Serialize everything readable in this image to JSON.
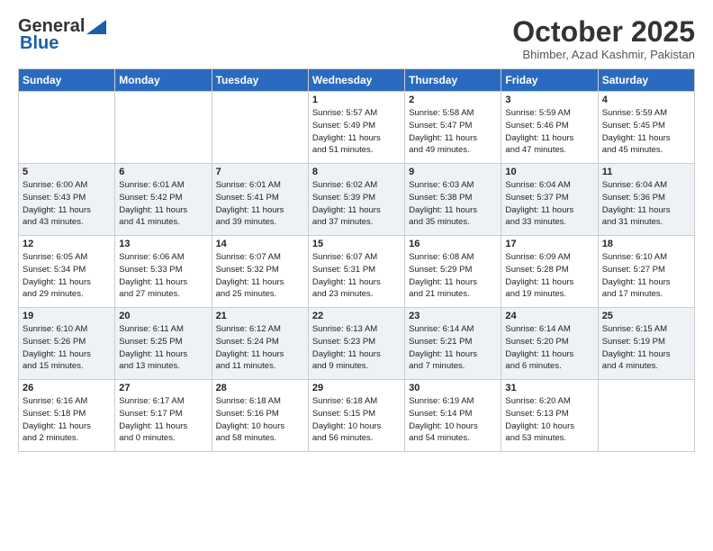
{
  "header": {
    "logo_general": "General",
    "logo_blue": "Blue",
    "month_title": "October 2025",
    "location": "Bhimber, Azad Kashmir, Pakistan"
  },
  "days_of_week": [
    "Sunday",
    "Monday",
    "Tuesday",
    "Wednesday",
    "Thursday",
    "Friday",
    "Saturday"
  ],
  "weeks": [
    [
      {
        "day": "",
        "info": ""
      },
      {
        "day": "",
        "info": ""
      },
      {
        "day": "",
        "info": ""
      },
      {
        "day": "1",
        "info": "Sunrise: 5:57 AM\nSunset: 5:49 PM\nDaylight: 11 hours\nand 51 minutes."
      },
      {
        "day": "2",
        "info": "Sunrise: 5:58 AM\nSunset: 5:47 PM\nDaylight: 11 hours\nand 49 minutes."
      },
      {
        "day": "3",
        "info": "Sunrise: 5:59 AM\nSunset: 5:46 PM\nDaylight: 11 hours\nand 47 minutes."
      },
      {
        "day": "4",
        "info": "Sunrise: 5:59 AM\nSunset: 5:45 PM\nDaylight: 11 hours\nand 45 minutes."
      }
    ],
    [
      {
        "day": "5",
        "info": "Sunrise: 6:00 AM\nSunset: 5:43 PM\nDaylight: 11 hours\nand 43 minutes."
      },
      {
        "day": "6",
        "info": "Sunrise: 6:01 AM\nSunset: 5:42 PM\nDaylight: 11 hours\nand 41 minutes."
      },
      {
        "day": "7",
        "info": "Sunrise: 6:01 AM\nSunset: 5:41 PM\nDaylight: 11 hours\nand 39 minutes."
      },
      {
        "day": "8",
        "info": "Sunrise: 6:02 AM\nSunset: 5:39 PM\nDaylight: 11 hours\nand 37 minutes."
      },
      {
        "day": "9",
        "info": "Sunrise: 6:03 AM\nSunset: 5:38 PM\nDaylight: 11 hours\nand 35 minutes."
      },
      {
        "day": "10",
        "info": "Sunrise: 6:04 AM\nSunset: 5:37 PM\nDaylight: 11 hours\nand 33 minutes."
      },
      {
        "day": "11",
        "info": "Sunrise: 6:04 AM\nSunset: 5:36 PM\nDaylight: 11 hours\nand 31 minutes."
      }
    ],
    [
      {
        "day": "12",
        "info": "Sunrise: 6:05 AM\nSunset: 5:34 PM\nDaylight: 11 hours\nand 29 minutes."
      },
      {
        "day": "13",
        "info": "Sunrise: 6:06 AM\nSunset: 5:33 PM\nDaylight: 11 hours\nand 27 minutes."
      },
      {
        "day": "14",
        "info": "Sunrise: 6:07 AM\nSunset: 5:32 PM\nDaylight: 11 hours\nand 25 minutes."
      },
      {
        "day": "15",
        "info": "Sunrise: 6:07 AM\nSunset: 5:31 PM\nDaylight: 11 hours\nand 23 minutes."
      },
      {
        "day": "16",
        "info": "Sunrise: 6:08 AM\nSunset: 5:29 PM\nDaylight: 11 hours\nand 21 minutes."
      },
      {
        "day": "17",
        "info": "Sunrise: 6:09 AM\nSunset: 5:28 PM\nDaylight: 11 hours\nand 19 minutes."
      },
      {
        "day": "18",
        "info": "Sunrise: 6:10 AM\nSunset: 5:27 PM\nDaylight: 11 hours\nand 17 minutes."
      }
    ],
    [
      {
        "day": "19",
        "info": "Sunrise: 6:10 AM\nSunset: 5:26 PM\nDaylight: 11 hours\nand 15 minutes."
      },
      {
        "day": "20",
        "info": "Sunrise: 6:11 AM\nSunset: 5:25 PM\nDaylight: 11 hours\nand 13 minutes."
      },
      {
        "day": "21",
        "info": "Sunrise: 6:12 AM\nSunset: 5:24 PM\nDaylight: 11 hours\nand 11 minutes."
      },
      {
        "day": "22",
        "info": "Sunrise: 6:13 AM\nSunset: 5:23 PM\nDaylight: 11 hours\nand 9 minutes."
      },
      {
        "day": "23",
        "info": "Sunrise: 6:14 AM\nSunset: 5:21 PM\nDaylight: 11 hours\nand 7 minutes."
      },
      {
        "day": "24",
        "info": "Sunrise: 6:14 AM\nSunset: 5:20 PM\nDaylight: 11 hours\nand 6 minutes."
      },
      {
        "day": "25",
        "info": "Sunrise: 6:15 AM\nSunset: 5:19 PM\nDaylight: 11 hours\nand 4 minutes."
      }
    ],
    [
      {
        "day": "26",
        "info": "Sunrise: 6:16 AM\nSunset: 5:18 PM\nDaylight: 11 hours\nand 2 minutes."
      },
      {
        "day": "27",
        "info": "Sunrise: 6:17 AM\nSunset: 5:17 PM\nDaylight: 11 hours\nand 0 minutes."
      },
      {
        "day": "28",
        "info": "Sunrise: 6:18 AM\nSunset: 5:16 PM\nDaylight: 10 hours\nand 58 minutes."
      },
      {
        "day": "29",
        "info": "Sunrise: 6:18 AM\nSunset: 5:15 PM\nDaylight: 10 hours\nand 56 minutes."
      },
      {
        "day": "30",
        "info": "Sunrise: 6:19 AM\nSunset: 5:14 PM\nDaylight: 10 hours\nand 54 minutes."
      },
      {
        "day": "31",
        "info": "Sunrise: 6:20 AM\nSunset: 5:13 PM\nDaylight: 10 hours\nand 53 minutes."
      },
      {
        "day": "",
        "info": ""
      }
    ]
  ]
}
